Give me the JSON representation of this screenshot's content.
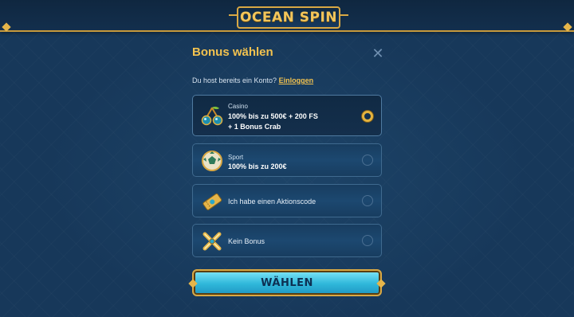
{
  "header": {
    "logo_text": "OCEAN SPIN"
  },
  "modal": {
    "title": "Bonus wählen",
    "login_prompt": "Du host bereits ein Konto?",
    "login_link": "Einloggen",
    "options": [
      {
        "icon": "cherries-icon",
        "category": "Casino",
        "line1": "100% bis zu 500€ + 200 FS",
        "line2": "+ 1 Bonus Crab",
        "selected": true
      },
      {
        "icon": "football-icon",
        "category": "Sport",
        "line1": "100% bis zu 200€",
        "selected": false
      },
      {
        "icon": "ticket-icon",
        "label": "Ich habe einen Aktionscode",
        "selected": false
      },
      {
        "icon": "crossed-x-icon",
        "label": "Kein Bonus",
        "selected": false
      }
    ],
    "submit_label": "WÄHLEN"
  },
  "colors": {
    "accent_gold": "#f2c24f",
    "background": "#17385a",
    "cta_cyan": "#2fb7da"
  }
}
